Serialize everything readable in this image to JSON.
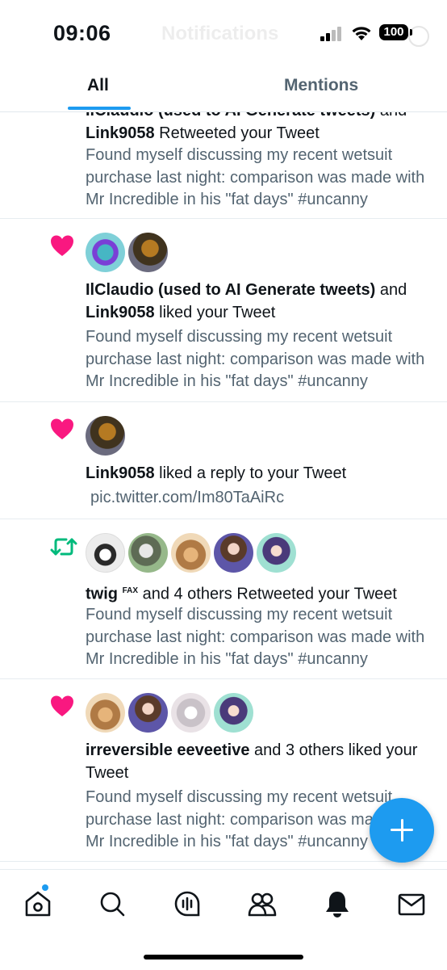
{
  "status_bar": {
    "time": "09:06",
    "battery": "100",
    "background_title": "Notifications"
  },
  "tabs": [
    {
      "label": "All",
      "selected": true
    },
    {
      "label": "Mentions",
      "selected": false
    }
  ],
  "notifications": [
    {
      "type": "retweet",
      "actors_top_cut": "IlClaudio (used to AI Generate tweets)",
      "actors_top_suffix": " and",
      "actor_line2_name": "Link9058",
      "action": " Retweeted your Tweet",
      "snippet": "Found myself discussing my recent wetsuit purchase last night: comparison was made with Mr Incredible in his \"fat days\" #uncanny"
    },
    {
      "type": "like",
      "icon": "heart-icon",
      "actor1": "IlClaudio (used to AI Generate tweets)",
      "joiner": " and",
      "actor2": "Link9058",
      "action": " liked your Tweet",
      "snippet": "Found myself discussing my recent wetsuit purchase last night: comparison was made with Mr Incredible in his \"fat days\" #uncanny"
    },
    {
      "type": "like",
      "icon": "heart-icon",
      "actor1": "Link9058",
      "action": " liked a reply to your Tweet",
      "link": "pic.twitter.com/Im80TaAiRc"
    },
    {
      "type": "retweet",
      "icon": "retweet-icon",
      "actor1": "twig",
      "actor1_sup": "FAX",
      "action": " and 4 others Retweeted your Tweet",
      "snippet": "Found myself discussing my recent wetsuit purchase last night: comparison was made with Mr Incredible in his \"fat days\" #uncanny"
    },
    {
      "type": "like",
      "icon": "heart-icon",
      "actor1": "irreversible eeveetive",
      "action": " and 3 others liked your Tweet",
      "snippet": "Found myself discussing my recent wetsuit purchase last night: comparison was made with Mr Incredible in his \"fat days\" #uncanny"
    }
  ],
  "bottom_nav": [
    {
      "name": "home",
      "icon": "home-icon",
      "has_badge": true
    },
    {
      "name": "search",
      "icon": "search-icon"
    },
    {
      "name": "spaces",
      "icon": "spaces-icon"
    },
    {
      "name": "communities",
      "icon": "communities-icon"
    },
    {
      "name": "notifications",
      "icon": "bell-icon",
      "selected": true
    },
    {
      "name": "messages",
      "icon": "mail-icon"
    }
  ],
  "colors": {
    "accent": "#1d9bf0",
    "like": "#f91880",
    "retweet": "#00ba7c",
    "secondary_text": "#536471"
  }
}
